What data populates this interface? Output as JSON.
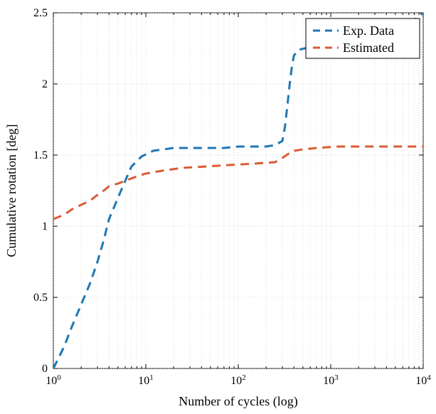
{
  "chart_data": {
    "type": "line",
    "title": "",
    "xlabel": "Number of cycles (log)",
    "ylabel": "Cumulative rotation [deg]",
    "xscale": "log",
    "xlim": [
      1,
      10000
    ],
    "ylim": [
      0,
      2.5
    ],
    "x_ticks_major": [
      1,
      10,
      100,
      1000,
      10000
    ],
    "x_tick_labels": [
      "10^0",
      "10^1",
      "10^2",
      "10^3",
      "10^4"
    ],
    "y_ticks_major": [
      0,
      0.5,
      1,
      1.5,
      2,
      2.5
    ],
    "grid": true,
    "legend": {
      "position": "upper-right",
      "entries": [
        "Exp. Data",
        "Estimated"
      ]
    },
    "series": [
      {
        "name": "Exp. Data",
        "color": "#1f77b4",
        "dash": true,
        "x": [
          1,
          1.3,
          1.6,
          2,
          2.5,
          3,
          3.5,
          4,
          5,
          6,
          7,
          9,
          12,
          20,
          40,
          70,
          100,
          150,
          200,
          250,
          300,
          320,
          340,
          360,
          380,
          400,
          450,
          520,
          700,
          1000,
          2000,
          4000,
          7000,
          10000
        ],
        "y": [
          0.0,
          0.15,
          0.3,
          0.45,
          0.6,
          0.75,
          0.9,
          1.05,
          1.2,
          1.32,
          1.42,
          1.49,
          1.53,
          1.55,
          1.55,
          1.55,
          1.56,
          1.56,
          1.56,
          1.57,
          1.6,
          1.7,
          1.85,
          2.0,
          2.12,
          2.2,
          2.24,
          2.25,
          2.26,
          2.27,
          2.3,
          2.35,
          2.42,
          2.5
        ]
      },
      {
        "name": "Estimated",
        "color": "#d95b34",
        "dash": true,
        "x": [
          1,
          1.3,
          1.6,
          2,
          2.5,
          3,
          3.5,
          4,
          5,
          6,
          8,
          10,
          15,
          25,
          45,
          80,
          150,
          250,
          300,
          350,
          400,
          500,
          700,
          1200,
          2500,
          5000,
          10000
        ],
        "y": [
          1.05,
          1.08,
          1.12,
          1.15,
          1.18,
          1.22,
          1.25,
          1.28,
          1.3,
          1.32,
          1.35,
          1.37,
          1.39,
          1.41,
          1.42,
          1.43,
          1.44,
          1.45,
          1.48,
          1.51,
          1.53,
          1.54,
          1.55,
          1.56,
          1.56,
          1.56,
          1.56
        ]
      }
    ]
  },
  "legend_labels": {
    "exp": "Exp. Data",
    "est": "Estimated"
  },
  "axis": {
    "xlabel": "Number of cycles (log)",
    "ylabel": "Cumulative rotation [deg]"
  },
  "ticks_y": {
    "t0": "0",
    "t1": "0.5",
    "t2": "1",
    "t3": "1.5",
    "t4": "2",
    "t5": "2.5"
  },
  "ticks_x_base": "10",
  "ticks_x_exp": {
    "e0": "0",
    "e1": "1",
    "e2": "2",
    "e3": "3",
    "e4": "4"
  }
}
